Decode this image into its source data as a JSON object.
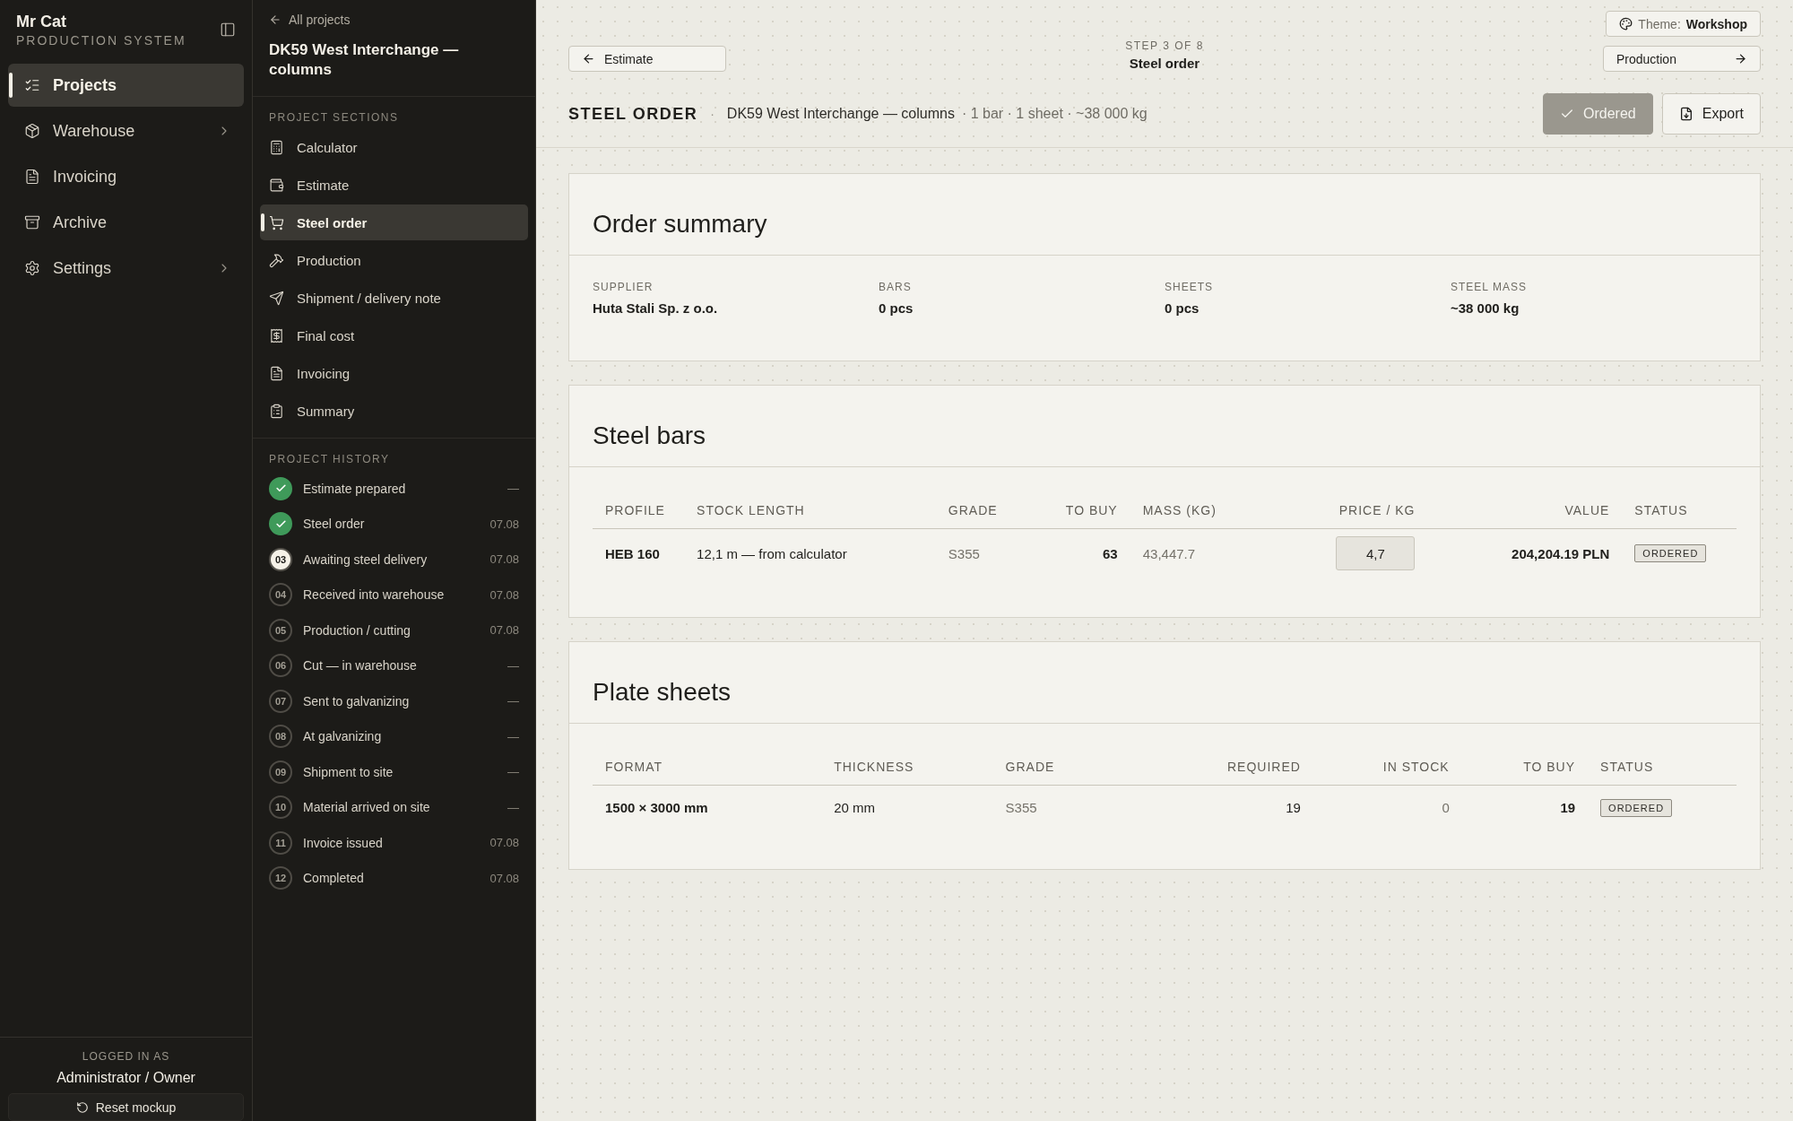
{
  "app": {
    "name": "Mr Cat",
    "subtitle": "PRODUCTION SYSTEM"
  },
  "nav": [
    {
      "label": "Projects",
      "selected": true,
      "submenu": false
    },
    {
      "label": "Warehouse",
      "selected": false,
      "submenu": true
    },
    {
      "label": "Invoicing",
      "selected": false,
      "submenu": false
    },
    {
      "label": "Archive",
      "selected": false,
      "submenu": false
    },
    {
      "label": "Settings",
      "selected": false,
      "submenu": true
    }
  ],
  "user": {
    "caption": "LOGGED IN AS",
    "name": "Administrator / Owner",
    "reset": "Reset mockup"
  },
  "project": {
    "back": "All projects",
    "title": "DK59 West Interchange — columns",
    "sections_heading": "PROJECT SECTIONS",
    "sections": [
      {
        "label": "Calculator",
        "selected": false
      },
      {
        "label": "Estimate",
        "selected": false
      },
      {
        "label": "Steel order",
        "selected": true
      },
      {
        "label": "Production",
        "selected": false
      },
      {
        "label": "Shipment / delivery note",
        "selected": false
      },
      {
        "label": "Final cost",
        "selected": false
      },
      {
        "label": "Invoicing",
        "selected": false
      },
      {
        "label": "Summary",
        "selected": false
      }
    ],
    "history_heading": "PROJECT HISTORY",
    "history": [
      {
        "kind": "done",
        "label": "Estimate prepared",
        "date": "—"
      },
      {
        "kind": "done",
        "label": "Steel order",
        "date": "07.08"
      },
      {
        "kind": "current",
        "number": "03",
        "label": "Awaiting steel delivery",
        "date": "07.08"
      },
      {
        "kind": "pending",
        "number": "04",
        "label": "Received into warehouse",
        "date": "07.08"
      },
      {
        "kind": "pending",
        "number": "05",
        "label": "Production / cutting",
        "date": "07.08"
      },
      {
        "kind": "pending",
        "number": "06",
        "label": "Cut — in warehouse",
        "date": "—"
      },
      {
        "kind": "pending",
        "number": "07",
        "label": "Sent to galvanizing",
        "date": "—"
      },
      {
        "kind": "pending",
        "number": "08",
        "label": "At galvanizing",
        "date": "—"
      },
      {
        "kind": "pending",
        "number": "09",
        "label": "Shipment to site",
        "date": "—"
      },
      {
        "kind": "pending",
        "number": "10",
        "label": "Material arrived on site",
        "date": "—"
      },
      {
        "kind": "pending",
        "number": "11",
        "label": "Invoice issued",
        "date": "07.08"
      },
      {
        "kind": "pending",
        "number": "12",
        "label": "Completed",
        "date": "07.08"
      }
    ]
  },
  "topbar": {
    "theme_label": "Theme:",
    "theme_value": "Workshop",
    "prev": "Estimate",
    "step": "STEP 3 OF 8",
    "step_name": "Steel order",
    "next": "Production"
  },
  "header": {
    "title": "STEEL ORDER",
    "separator": "·",
    "project": "DK59 West Interchange — columns",
    "meta": "· 1 bar · 1 sheet · ~38 000 kg",
    "ordered": "Ordered",
    "export": "Export"
  },
  "summary": {
    "title": "Order summary",
    "stats": [
      {
        "label": "SUPPLIER",
        "value": "Huta Stali Sp. z o.o."
      },
      {
        "label": "BARS",
        "value": "0 pcs"
      },
      {
        "label": "SHEETS",
        "value": "0 pcs"
      },
      {
        "label": "STEEL MASS",
        "value": "~38 000 kg"
      }
    ]
  },
  "bars": {
    "title": "Steel bars",
    "columns": [
      "PROFILE",
      "STOCK LENGTH",
      "GRADE",
      "TO BUY",
      "MASS (KG)",
      "PRICE / KG",
      "VALUE",
      "STATUS"
    ],
    "rows": [
      {
        "profile": "HEB 160",
        "stock_length": "12,1 m — from calculator",
        "grade": "S355",
        "to_buy": "63",
        "mass": "43,447.7",
        "price": "4,7",
        "value": "204,204.19 PLN",
        "status": "ORDERED"
      }
    ]
  },
  "sheets": {
    "title": "Plate sheets",
    "columns": [
      "FORMAT",
      "THICKNESS",
      "GRADE",
      "REQUIRED",
      "IN STOCK",
      "TO BUY",
      "STATUS"
    ],
    "rows": [
      {
        "format": "1500 × 3000 mm",
        "thickness": "20 mm",
        "grade": "S355",
        "required": "19",
        "in_stock": "0",
        "to_buy": "19",
        "status": "ORDERED"
      }
    ]
  }
}
